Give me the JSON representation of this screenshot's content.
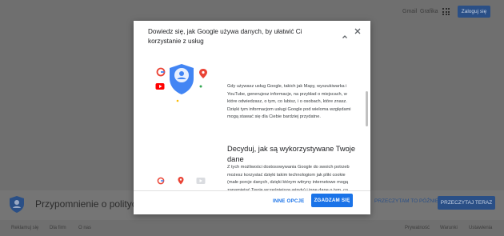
{
  "background": {
    "topbar": {
      "gmail": "Gmail",
      "images": "Grafika",
      "apps_icon": "apps-grid-icon",
      "signin": "Zaloguj się"
    },
    "banner": {
      "title": "Przypomnienie o polityce",
      "later_button": "PRZECZYTAM TO PÓŹNIEJ",
      "review_button": "PRZECZYTAJ TERAZ"
    },
    "footer": {
      "ads": "Reklamuj się",
      "business": "Dla firm",
      "about": "O nas",
      "privacy": "Prywatność",
      "terms": "Warunki",
      "settings": "Ustawienia"
    }
  },
  "modal": {
    "header": "Dowiedz się, jak Google używa danych, by ułatwić Ci korzystanie z usług",
    "section1_text": "Gdy używasz usług Google, takich jak Mapy, wyszukiwarka i YouTube, generujesz informacje, na przykład o miejscach, w które odwiedzasz, o tym, co lubisz, i o osobach, które znasz. Dzięki tym informacjom usługi Google pod wieloma względami mogą stawać się dla Ciebie bardziej przydatne.",
    "section2_heading": "Decyduj, jak są wykorzystywane Twoje dane",
    "section2_text": "Z tych możliwości dostosowywania Google do swoich potrzeb możesz korzystać dzięki takim technologiom jak pliki cookie (małe porcje danych, dzięki którym witryny internetowe mogą zapamiętać Twoje wcześniejsze wizyty) i inne dane o tym, co robisz w",
    "more_options": "INNE OPCJE",
    "agree": "ZGADZAM SIĘ"
  },
  "colors": {
    "accent": "#1a73e8",
    "google_red": "#ea4335",
    "google_yellow": "#fbbc04",
    "google_green": "#34a853",
    "youtube_red": "#ff0000"
  }
}
